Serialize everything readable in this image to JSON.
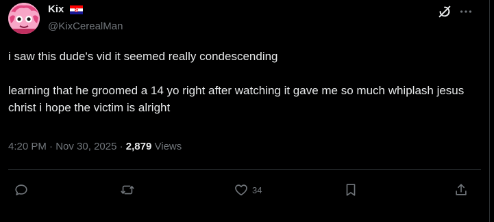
{
  "author": {
    "display_name": "Kix",
    "handle": "@KixCerealMan",
    "flag": "croatia-flag"
  },
  "post": {
    "lines": [
      "i saw this dude's vid it seemed really condescending",
      "learning that he groomed a 14 yo right after watching it gave me so much whiplash jesus christ i hope the victim is alright"
    ],
    "time": "4:20 PM",
    "date": "Nov 30, 2025",
    "views_count": "2,879",
    "views_label": "Views"
  },
  "actions": {
    "reply_count": "",
    "repost_count": "",
    "like_count": "34"
  },
  "icons": {
    "grok": "grok-icon",
    "more": "more-icon",
    "reply": "reply-icon",
    "repost": "repost-icon",
    "like": "heart-icon",
    "bookmark": "bookmark-icon",
    "share": "share-icon"
  },
  "colors": {
    "background": "#000000",
    "text": "#e7e9ea",
    "muted": "#71767b",
    "divider": "#2f3336",
    "avatar_pink": "#f7a6c7"
  }
}
